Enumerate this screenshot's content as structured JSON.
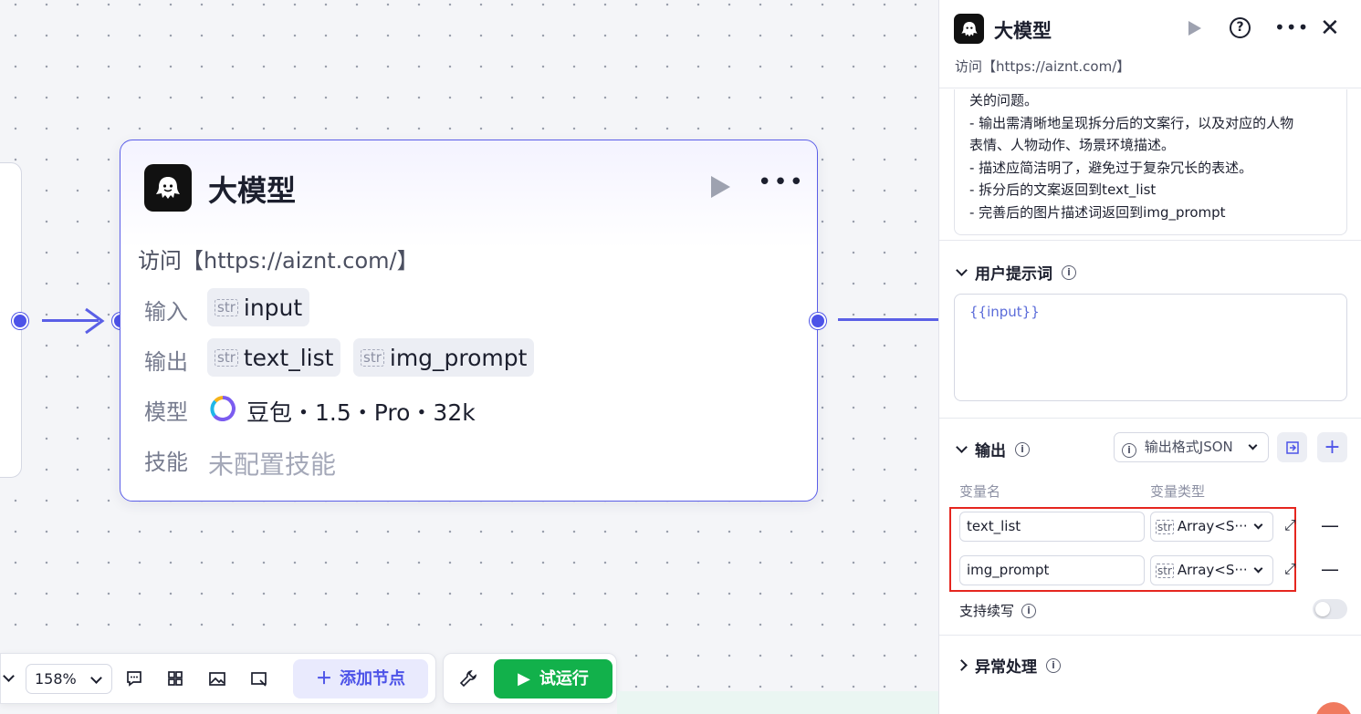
{
  "canvas": {
    "node": {
      "title": "大模型",
      "description": "访问【https://aiznt.com/】",
      "input_label": "输入",
      "input_tag": "input",
      "output_label": "输出",
      "output_tags": [
        "text_list",
        "img_prompt"
      ],
      "model_label": "模型",
      "model_value": "豆包・1.5・Pro・32k",
      "skill_label": "技能",
      "skill_value": "未配置技能",
      "str_badge": "str"
    }
  },
  "toolbar": {
    "zoom": "158%",
    "add_node_label": "添加节点",
    "run_label": "试运行"
  },
  "panel": {
    "title": "大模型",
    "description": "访问【https://aiznt.com/】",
    "system_prompt_lines": [
      "关的问题。",
      "- 输出需清晰地呈现拆分后的文案行，以及对应的人物",
      "表情、人物动作、场景环境描述。",
      "- 描述应简洁明了，避免过于复杂冗长的表述。",
      "- 拆分后的文案返回到text_list",
      "- 完善后的图片描述词返回到img_prompt"
    ],
    "user_prompt_header": "用户提示词",
    "user_prompt_value": "{{input}}",
    "output_header": "输出",
    "output_format": "输出格式JSON",
    "col_var_name": "变量名",
    "col_var_type": "变量类型",
    "variables": [
      {
        "name": "text_list",
        "type": "Array<S···"
      },
      {
        "name": "img_prompt",
        "type": "Array<S···"
      }
    ],
    "support_continue": "支持续写",
    "error_handling": "异常处理"
  },
  "colors": {
    "accent": "#4d53e8",
    "run_green": "#12b14b",
    "highlight_red": "#e5261f"
  }
}
